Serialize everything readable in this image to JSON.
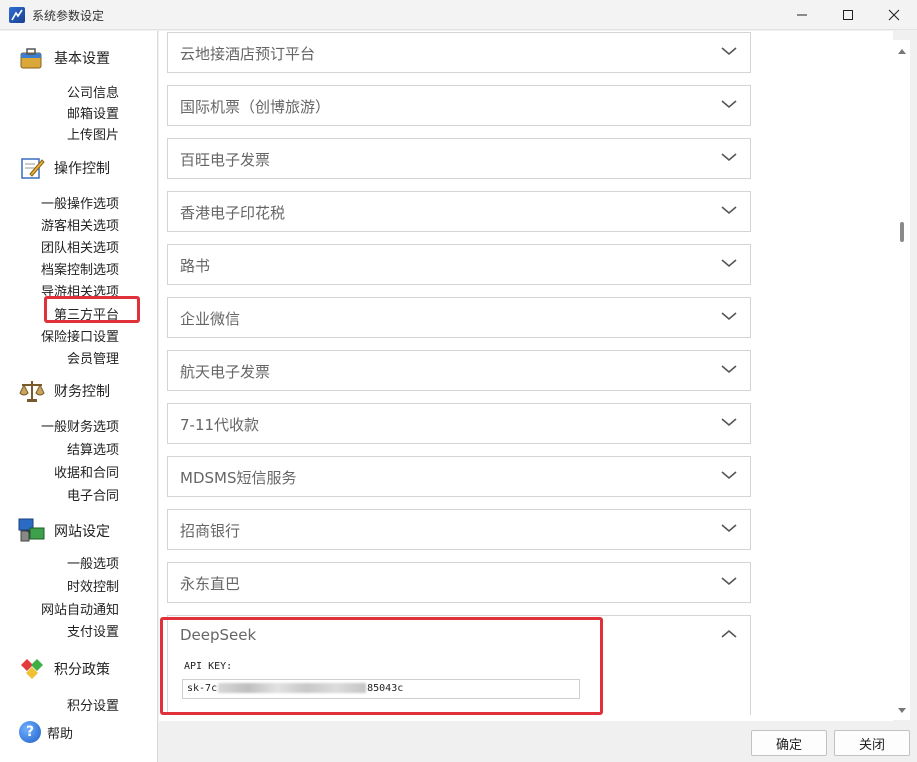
{
  "window": {
    "title": "系统参数设定",
    "controls": {
      "minimize": "minimize-icon",
      "maximize": "maximize-icon",
      "close": "close-icon"
    }
  },
  "sidebar": {
    "groups": [
      {
        "label": "基本设置",
        "icon": "toolbox-icon",
        "items": [
          "公司信息",
          "邮箱设置",
          "上传图片"
        ]
      },
      {
        "label": "操作控制",
        "icon": "notepad-pencil-icon",
        "items": [
          "一般操作选项",
          "游客相关选项",
          "团队相关选项",
          "档案控制选项",
          "导游相关选项",
          "第三方平台",
          "保险接口设置",
          "会员管理"
        ]
      },
      {
        "label": "财务控制",
        "icon": "scales-icon",
        "items": [
          "一般财务选项",
          "结算选项",
          "收据和合同",
          "电子合同"
        ]
      },
      {
        "label": "网站设定",
        "icon": "network-computers-icon",
        "items": [
          "一般选项",
          "时效控制",
          "网站自动通知",
          "支付设置"
        ]
      },
      {
        "label": "积分政策",
        "icon": "gems-icon",
        "items": [
          "积分设置"
        ]
      }
    ],
    "selected_item": "第三方平台",
    "help_label": "帮助"
  },
  "main": {
    "panels": [
      "云地接酒店预订平台",
      "国际机票（创博旅游）",
      "百旺电子发票",
      "香港电子印花税",
      "路书",
      "企业微信",
      "航天电子发票",
      "7-11代收款",
      "MDSMS短信服务",
      "招商银行",
      "永东直巴"
    ],
    "expanded_panel": {
      "title": "DeepSeek",
      "api_key_label": "API KEY:",
      "api_key_prefix": "sk-7c",
      "api_key_suffix": "85043c"
    }
  },
  "footer": {
    "ok_label": "确定",
    "close_label": "关闭"
  },
  "colors": {
    "highlight": "#e0303a",
    "panel_border": "#d4d4d4",
    "panel_title": "#666666"
  }
}
